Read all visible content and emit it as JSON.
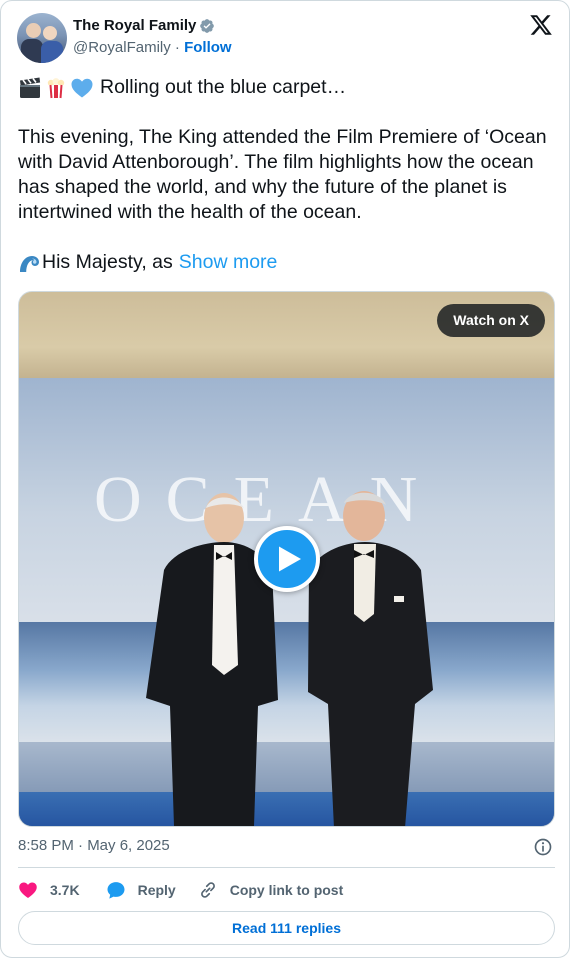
{
  "author": {
    "display_name": "The Royal Family",
    "handle": "@RoyalFamily",
    "separator": " · ",
    "follow_label": "Follow",
    "verified": true
  },
  "post": {
    "first_line": "Rolling out the blue carpet…",
    "first_line_emojis": [
      "clapper-board-icon",
      "popcorn-icon",
      "blue-heart-icon"
    ],
    "paragraph": "This evening, The King attended the Film Premiere of ‘Ocean with David Attenborough’. The film highlights how the ocean has shaped the world, and why the future of the planet is intertwined with the health of the ocean.",
    "last_line_emoji": "wave-icon",
    "last_line": "His Majesty, as",
    "show_more": "Show more"
  },
  "media": {
    "watch_label": "Watch on X",
    "backdrop_text": "OCEAN",
    "type": "video"
  },
  "meta": {
    "timestamp": "8:58 PM · May 6, 2025"
  },
  "actions": {
    "likes": "3.7K",
    "reply_label": "Reply",
    "copy_label": "Copy link to post"
  },
  "read_replies": "Read 111 replies",
  "colors": {
    "accent": "#1d9bf0",
    "link": "#006fd6",
    "like": "#f91880",
    "muted": "#536471",
    "border": "#cfd9de"
  }
}
